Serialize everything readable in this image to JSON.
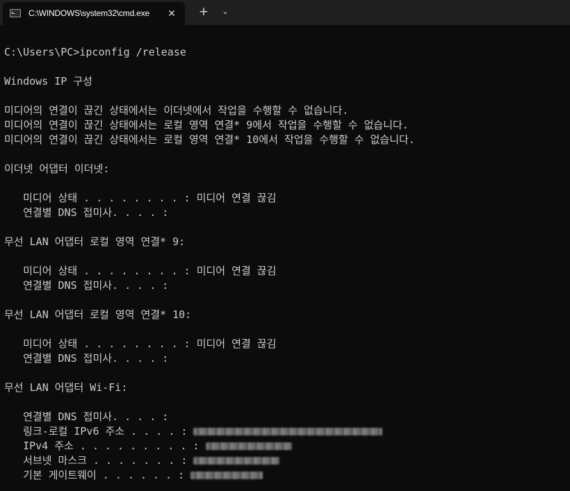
{
  "tab": {
    "icon": "terminal-icon",
    "title": "C:\\WINDOWS\\system32\\cmd.exe",
    "close_symbol": "✕",
    "new_tab_symbol": "+",
    "dropdown_symbol": "⌄"
  },
  "console": {
    "prompt": "C:\\Users\\PC>ipconfig /release",
    "config_header": "Windows IP 구성",
    "messages": [
      "미디어의 연결이 끊긴 상태에서는 이더넷에서 작업을 수행할 수 없습니다.",
      "미디어의 연결이 끊긴 상태에서는 로컬 영역 연결* 9에서 작업을 수행할 수 없습니다.",
      "미디어의 연결이 끊긴 상태에서는 로컬 영역 연결* 10에서 작업을 수행할 수 없습니다."
    ],
    "adapters": [
      {
        "header": "이더넷 어댑터 이더넷:",
        "media_state": "   미디어 상태 . . . . . . . . : 미디어 연결 끊김",
        "dns_suffix": "   연결별 DNS 접미사. . . . :"
      },
      {
        "header": "무선 LAN 어댑터 로컬 영역 연결* 9:",
        "media_state": "   미디어 상태 . . . . . . . . : 미디어 연결 끊김",
        "dns_suffix": "   연결별 DNS 접미사. . . . :"
      },
      {
        "header": "무선 LAN 어댑터 로컬 영역 연결* 10:",
        "media_state": "   미디어 상태 . . . . . . . . : 미디어 연결 끊김",
        "dns_suffix": "   연결별 DNS 접미사. . . . :"
      }
    ],
    "wifi": {
      "header": "무선 LAN 어댑터 Wi-Fi:",
      "dns_suffix": "   연결별 DNS 접미사. . . . :",
      "ipv6_label": "   링크-로컬 IPv6 주소 . . . . :",
      "ipv4_label": "   IPv4 주소 . . . . . . . . . :",
      "subnet_label": "   서브넷 마스크 . . . . . . . :",
      "gateway_label": "   기본 게이트웨이 . . . . . . :"
    }
  },
  "colors": {
    "background": "#0c0c0c",
    "text": "#cccccc",
    "titlebar": "#1f1f1f"
  }
}
